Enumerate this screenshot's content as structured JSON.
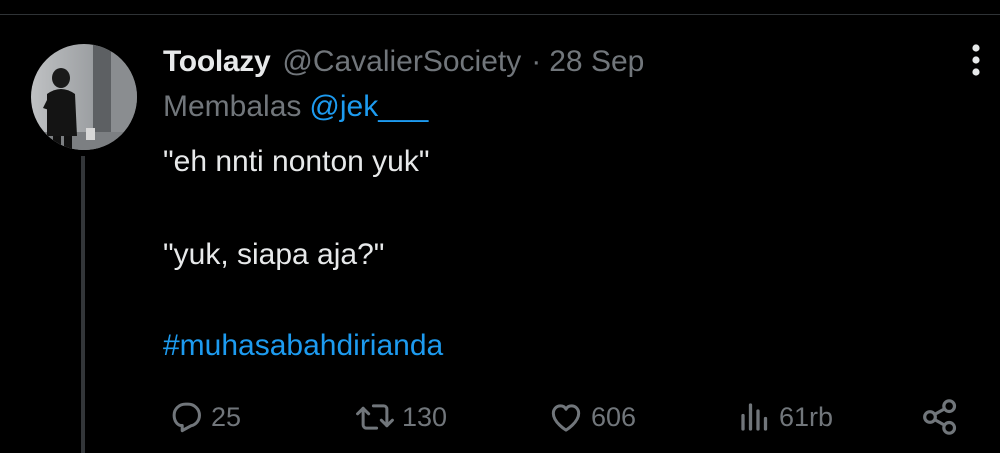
{
  "tweet": {
    "display_name": "Toolazy",
    "handle": "@CavalierSociety",
    "separator": "·",
    "date": "28 Sep",
    "replying_label": "Membalas",
    "replying_to": "@jek___",
    "text_lines": [
      "\"eh nnti nonton yuk\"",
      "\"yuk, siapa aja?\""
    ],
    "hashtag": "#muhasabahdirianda"
  },
  "actions": {
    "replies": {
      "icon": "reply-icon",
      "count": "25"
    },
    "retweets": {
      "icon": "retweet-icon",
      "count": "130"
    },
    "likes": {
      "icon": "heart-icon",
      "count": "606"
    },
    "views": {
      "icon": "analytics-icon",
      "count": "61rb"
    },
    "share": {
      "icon": "share-icon"
    }
  },
  "colors": {
    "background": "#000000",
    "text_primary": "#e7e9ea",
    "text_secondary": "#71767b",
    "accent": "#1d9bf0",
    "thread_line": "#333639"
  }
}
